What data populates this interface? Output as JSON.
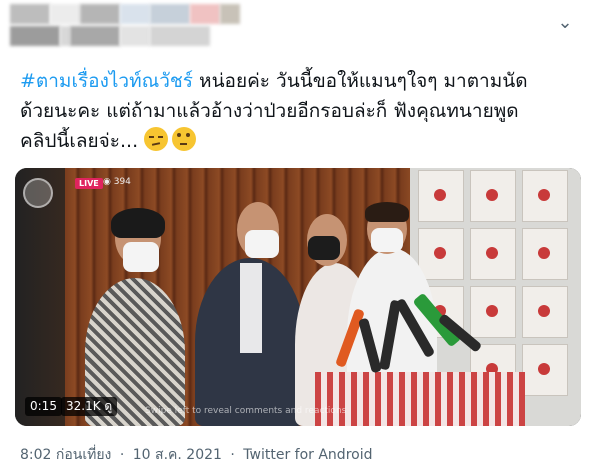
{
  "tweet": {
    "hashtag": "#ตามเรื่องไวท์ณวัชร์",
    "text_line1_rest": " หน่อยค่ะ วันนี้ขอให้แมนๆใจๆ มาตามนัด",
    "text_line2": "ด้วยนะคะ แต่ถ้ามาแล้วอ้างว่าป่วยอีกรอบล่ะก็ ฟังคุณทนายพูด",
    "text_line3": "คลิปนี้เลยจ่ะ...",
    "emojis": [
      "smirking-face",
      "face-with-rolling-eyes"
    ]
  },
  "media": {
    "live_label": "LIVE",
    "viewers": "394",
    "swipe_hint": "Swipe left to reveal comments and reactions",
    "time": "0:15",
    "views": "32.1K ดู"
  },
  "meta": {
    "time": "8:02 ก่อนเที่ยง",
    "separator1": "·",
    "date": "10 ส.ค. 2021",
    "separator2": "·",
    "client": "Twitter for Android"
  },
  "colors": {
    "hashtag": "#1d9bf0",
    "text": "#0f1419",
    "secondary": "#536471"
  }
}
